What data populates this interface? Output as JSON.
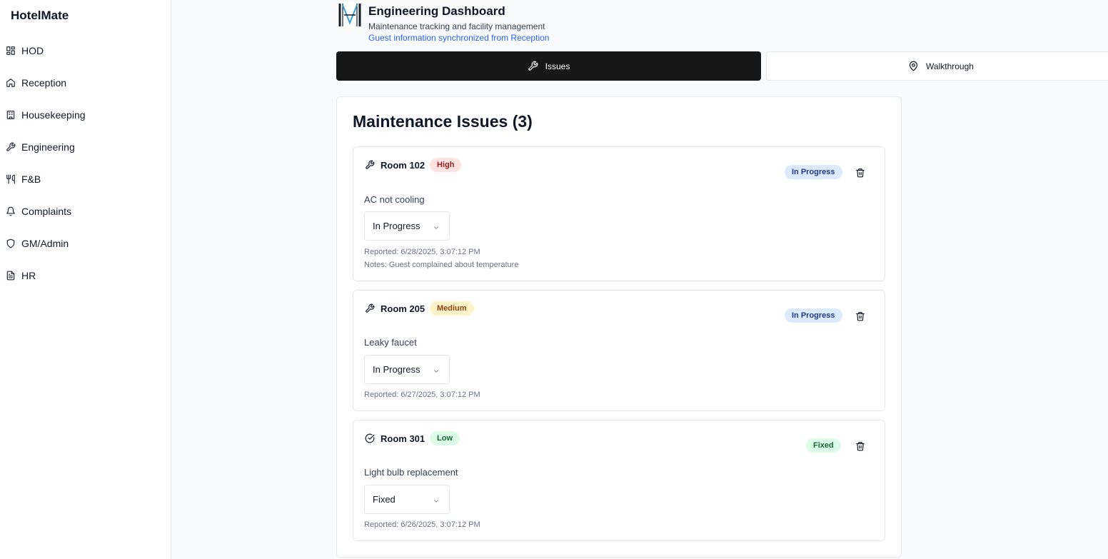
{
  "app": {
    "brand": "HotelMate"
  },
  "sidebar": {
    "items": [
      {
        "label": "HOD",
        "icon": "layout-grid-icon"
      },
      {
        "label": "Reception",
        "icon": "home-icon"
      },
      {
        "label": "Housekeeping",
        "icon": "building-icon"
      },
      {
        "label": "Engineering",
        "icon": "wrench-icon"
      },
      {
        "label": "F&B",
        "icon": "utensils-icon"
      },
      {
        "label": "Complaints",
        "icon": "bell-icon"
      },
      {
        "label": "GM/Admin",
        "icon": "shield-icon"
      },
      {
        "label": "HR",
        "icon": "file-text-icon"
      }
    ]
  },
  "header": {
    "logo": "hm-logo",
    "title": "Engineering Dashboard",
    "subtitle": "Maintenance tracking and facility management",
    "sync_note": "Guest information synchronized from Reception"
  },
  "tabs": [
    {
      "label": "Issues",
      "icon": "wrench-icon",
      "active": true
    },
    {
      "label": "Walkthrough",
      "icon": "map-pin-icon",
      "active": false
    }
  ],
  "issues_panel": {
    "title": "Maintenance Issues (3)",
    "issues": [
      {
        "room": "Room 102",
        "priority": "High",
        "status": "In Progress",
        "description": "AC not cooling",
        "selected_status": "In Progress",
        "reported": "Reported: 6/28/2025, 3:07:12 PM",
        "notes": "Notes: Guest complained about temperature",
        "icon": "wrench-icon"
      },
      {
        "room": "Room 205",
        "priority": "Medium",
        "status": "In Progress",
        "description": "Leaky faucet",
        "selected_status": "In Progress",
        "reported": "Reported: 6/27/2025, 3:07:12 PM",
        "icon": "wrench-icon"
      },
      {
        "room": "Room 301",
        "priority": "Low",
        "status": "Fixed",
        "description": "Light bulb replacement",
        "selected_status": "Fixed",
        "reported": "Reported: 6/26/2025, 3:07:12 PM",
        "icon": "check-circle-icon"
      }
    ]
  },
  "colors": {
    "accent": "#171717",
    "link": "#2563eb",
    "high_bg": "#fee2e2",
    "medium_bg": "#fef3c7",
    "low_bg": "#dcfce7",
    "in_progress_bg": "#dbeafe"
  }
}
